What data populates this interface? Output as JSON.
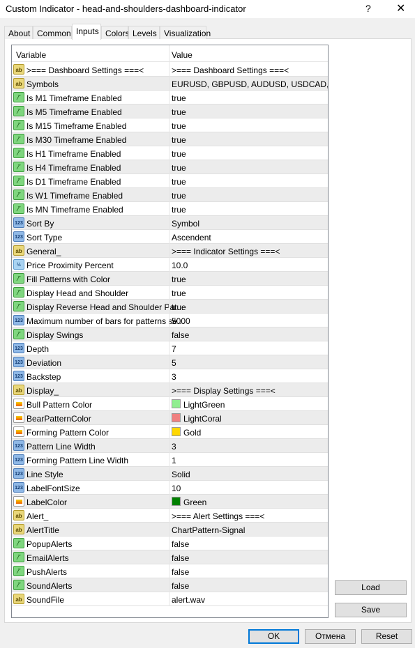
{
  "window": {
    "title": "Custom Indicator - head-and-shoulders-dashboard-indicator",
    "help": "?",
    "close": "✕"
  },
  "tabs": [
    "About",
    "Common",
    "Inputs",
    "Colors",
    "Levels",
    "Visualization"
  ],
  "active_tab": "Inputs",
  "grid": {
    "col_variable": "Variable",
    "col_value": "Value",
    "rows": [
      {
        "icon": "ab",
        "name": ">=== Dashboard Settings ===<",
        "value": ">=== Dashboard Settings ===<"
      },
      {
        "icon": "ab",
        "name": "Symbols",
        "value": "EURUSD, GBPUSD, AUDUSD, USDCAD, ..."
      },
      {
        "icon": "bool",
        "name": "Is M1 Timeframe Enabled",
        "value": "true"
      },
      {
        "icon": "bool",
        "name": "Is M5 Timeframe Enabled",
        "value": "true"
      },
      {
        "icon": "bool",
        "name": "Is M15 Timeframe Enabled",
        "value": "true"
      },
      {
        "icon": "bool",
        "name": "Is M30 Timeframe Enabled",
        "value": "true"
      },
      {
        "icon": "bool",
        "name": "Is H1 Timeframe Enabled",
        "value": "true"
      },
      {
        "icon": "bool",
        "name": "Is H4 Timeframe Enabled",
        "value": "true"
      },
      {
        "icon": "bool",
        "name": "Is D1 Timeframe Enabled",
        "value": "true"
      },
      {
        "icon": "bool",
        "name": "Is W1 Timeframe Enabled",
        "value": "true"
      },
      {
        "icon": "bool",
        "name": "Is MN Timeframe Enabled",
        "value": "true"
      },
      {
        "icon": "num",
        "name": "Sort By",
        "value": "Symbol"
      },
      {
        "icon": "num",
        "name": "Sort Type",
        "value": "Ascendent"
      },
      {
        "icon": "ab",
        "name": "General_",
        "value": ">=== Indicator Settings ===<"
      },
      {
        "icon": "dbl",
        "name": "Price Proximity Percent",
        "value": "10.0"
      },
      {
        "icon": "bool",
        "name": "Fill Patterns with Color",
        "value": "true"
      },
      {
        "icon": "bool",
        "name": "Display Head and Shoulder",
        "value": "true"
      },
      {
        "icon": "bool",
        "name": "Display Reverse Head and Shoulder Pat...",
        "value": "true"
      },
      {
        "icon": "num",
        "name": "Maximum number of bars for patterns se...",
        "value": "5000"
      },
      {
        "icon": "bool",
        "name": "Display Swings",
        "value": "false"
      },
      {
        "icon": "num",
        "name": "Depth",
        "value": "7"
      },
      {
        "icon": "num",
        "name": "Deviation",
        "value": "5"
      },
      {
        "icon": "num",
        "name": "Backstep",
        "value": "3"
      },
      {
        "icon": "ab",
        "name": "Display_",
        "value": ">=== Display Settings ===<"
      },
      {
        "icon": "col",
        "name": "Bull Pattern Color",
        "value": "LightGreen",
        "swatch": "#90ee90"
      },
      {
        "icon": "col",
        "name": "BearPatternColor",
        "value": "LightCoral",
        "swatch": "#f08080"
      },
      {
        "icon": "col",
        "name": "Forming Pattern Color",
        "value": "Gold",
        "swatch": "#ffd700"
      },
      {
        "icon": "num",
        "name": "Pattern Line Width",
        "value": "3"
      },
      {
        "icon": "num",
        "name": "Forming Pattern Line Width",
        "value": "1"
      },
      {
        "icon": "num",
        "name": "Line Style",
        "value": "Solid"
      },
      {
        "icon": "num",
        "name": "LabelFontSize",
        "value": "10"
      },
      {
        "icon": "col",
        "name": "LabelColor",
        "value": "Green",
        "swatch": "#008000"
      },
      {
        "icon": "ab",
        "name": "Alert_",
        "value": ">=== Alert Settings ===<"
      },
      {
        "icon": "ab",
        "name": "AlertTitle",
        "value": "ChartPattern-Signal"
      },
      {
        "icon": "bool",
        "name": "PopupAlerts",
        "value": "false"
      },
      {
        "icon": "bool",
        "name": "EmailAlerts",
        "value": "false"
      },
      {
        "icon": "bool",
        "name": "PushAlerts",
        "value": "false"
      },
      {
        "icon": "bool",
        "name": "SoundAlerts",
        "value": "false"
      },
      {
        "icon": "ab",
        "name": "SoundFile",
        "value": "alert.wav"
      }
    ]
  },
  "icon_glyphs": {
    "ab": "ab",
    "bool": "⁄‾",
    "num": "123",
    "dbl": "½",
    "col": ""
  },
  "buttons": {
    "load": "Load",
    "save": "Save",
    "ok": "OK",
    "cancel": "Отмена",
    "reset": "Reset"
  }
}
